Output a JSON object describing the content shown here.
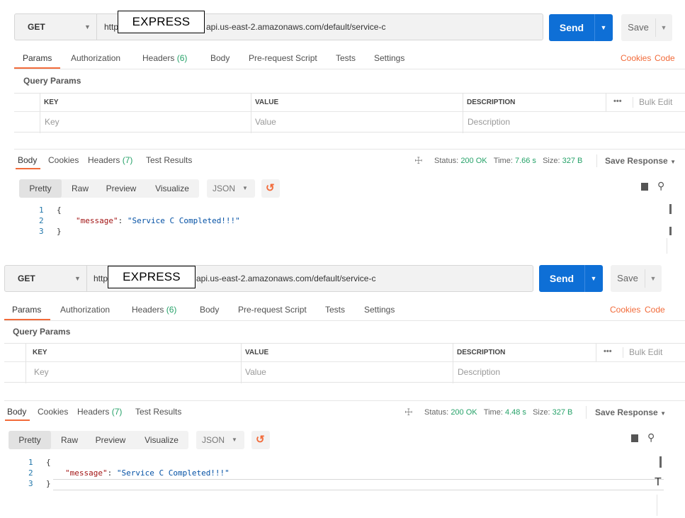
{
  "panels": [
    {
      "method": "GET",
      "url_prefix": "http",
      "url_suffix": "api.us-east-2.amazonaws.com/default/service-c",
      "overlay_label": "EXPRESS",
      "send_label": "Send",
      "save_label": "Save",
      "request_tabs": {
        "params": "Params",
        "authorization": "Authorization",
        "headers": "Headers",
        "headers_count": "(6)",
        "body": "Body",
        "pre_request": "Pre-request Script",
        "tests": "Tests",
        "settings": "Settings",
        "cookies": "Cookies",
        "code": "Code"
      },
      "query_params_title": "Query Params",
      "table": {
        "headers": [
          "KEY",
          "VALUE",
          "DESCRIPTION"
        ],
        "placeholders": [
          "Key",
          "Value",
          "Description"
        ],
        "more": "•••",
        "bulk_edit": "Bulk Edit"
      },
      "response_tabs": {
        "body": "Body",
        "cookies": "Cookies",
        "headers": "Headers",
        "headers_count": "(7)",
        "test_results": "Test Results"
      },
      "status_label": "Status:",
      "status_value": "200 OK",
      "time_label": "Time:",
      "time_value": "7.66 s",
      "size_label": "Size:",
      "size_value": "327 B",
      "save_response": "Save Response",
      "format_buttons": [
        "Pretty",
        "Raw",
        "Preview",
        "Visualize"
      ],
      "format_select": "JSON",
      "line_numbers": [
        "1",
        "2",
        "3"
      ],
      "code": {
        "open": "{",
        "key": "\"message\"",
        "colon": ": ",
        "value": "\"Service C Completed!!!\"",
        "close": "}"
      }
    },
    {
      "method": "GET",
      "url_prefix": "https",
      "url_suffix": "api.us-east-2.amazonaws.com/default/service-c",
      "overlay_label": "EXPRESS",
      "send_label": "Send",
      "save_label": "Save",
      "request_tabs": {
        "params": "Params",
        "authorization": "Authorization",
        "headers": "Headers",
        "headers_count": "(6)",
        "body": "Body",
        "pre_request": "Pre-request Script",
        "tests": "Tests",
        "settings": "Settings",
        "cookies": "Cookies",
        "code": "Code"
      },
      "query_params_title": "Query Params",
      "table": {
        "headers": [
          "KEY",
          "VALUE",
          "DESCRIPTION"
        ],
        "placeholders": [
          "Key",
          "Value",
          "Description"
        ],
        "more": "•••",
        "bulk_edit": "Bulk Edit"
      },
      "response_tabs": {
        "body": "Body",
        "cookies": "Cookies",
        "headers": "Headers",
        "headers_count": "(7)",
        "test_results": "Test Results"
      },
      "status_label": "Status:",
      "status_value": "200 OK",
      "time_label": "Time:",
      "time_value": "4.48 s",
      "size_label": "Size:",
      "size_value": "327 B",
      "save_response": "Save Response",
      "format_buttons": [
        "Pretty",
        "Raw",
        "Preview",
        "Visualize"
      ],
      "format_select": "JSON",
      "line_numbers": [
        "1",
        "2",
        "3"
      ],
      "code": {
        "open": "{",
        "key": "\"message\"",
        "colon": ": ",
        "value": "\"Service C Completed!!!\"",
        "close": "}"
      }
    }
  ],
  "colors": {
    "accent": "#f26b3a",
    "send_blue": "#0e6fd6",
    "status_green": "#26a269"
  }
}
